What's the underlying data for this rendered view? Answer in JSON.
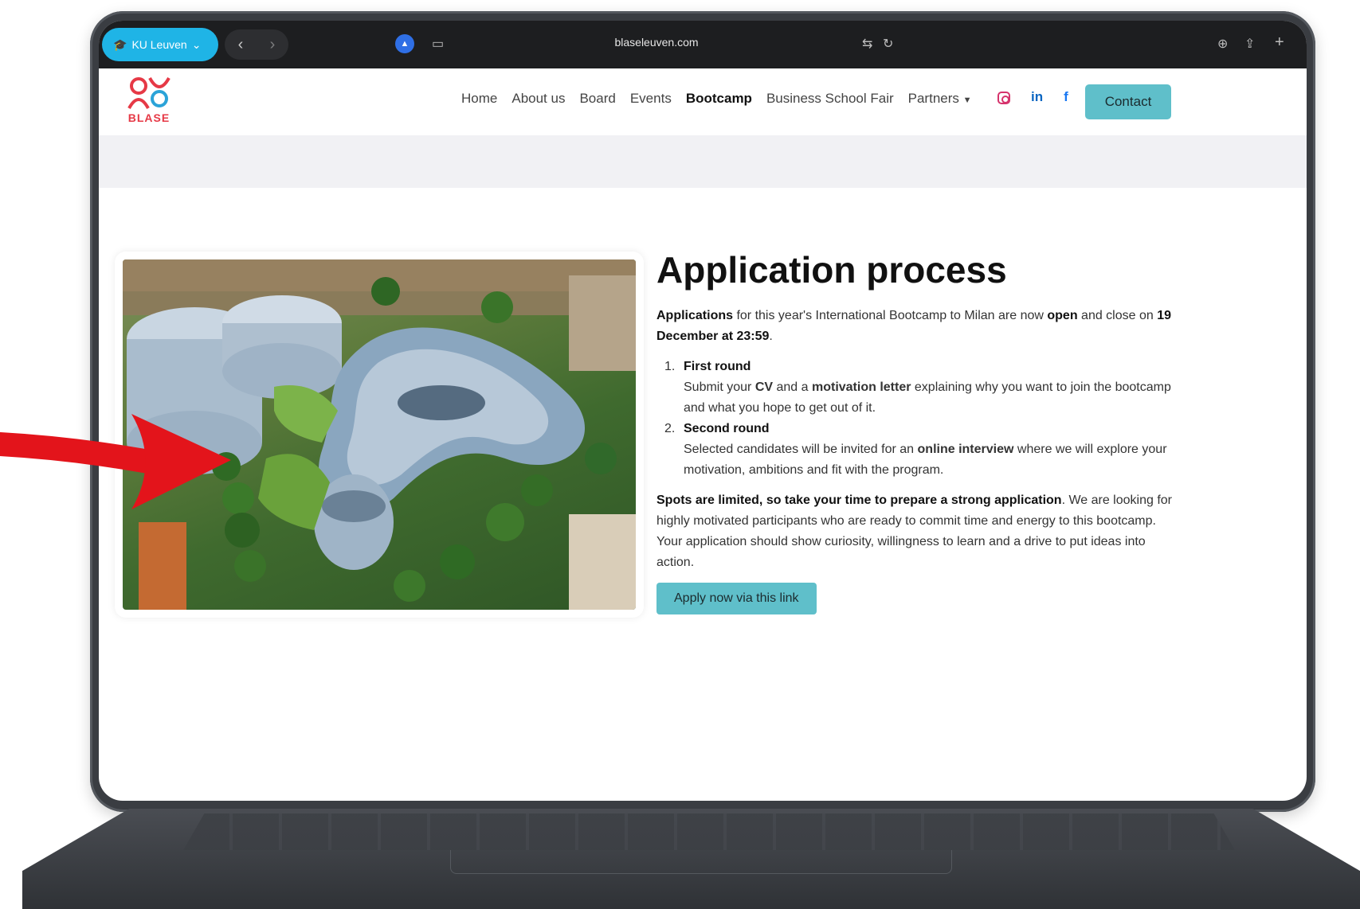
{
  "browser": {
    "profile": "KU Leuven",
    "url": "blaseleuven.com"
  },
  "site": {
    "logo_text": "BLASE",
    "nav": [
      "Home",
      "About us",
      "Board",
      "Events",
      "Bootcamp",
      "Business School Fair",
      "Partners"
    ],
    "active_nav": "Bootcamp",
    "contact_label": "Contact"
  },
  "content": {
    "title": "Application process",
    "intro_bold1": "Applications",
    "intro_text1": " for this year's International Bootcamp to Milan are now ",
    "intro_bold2": "open",
    "intro_text2": " and close on ",
    "intro_bold3": "19 December at 23:59",
    "intro_text3": ".",
    "steps": [
      {
        "number": "1.",
        "title": "First round",
        "pre": "Submit your ",
        "b1": "CV",
        "mid": " and a ",
        "b2": "motivation letter",
        "post": " explaining why you want to join the bootcamp and what you hope to get out of it."
      },
      {
        "number": "2.",
        "title": "Second round",
        "pre": "Selected candidates will be invited for an ",
        "b1": "online interview",
        "post": " where we will explore your motivation, ambitions and fit with the program."
      }
    ],
    "outro_bold": "Spots are limited, so take your time to prepare a strong application",
    "outro_text": ". We are looking for highly motivated participants who are ready to commit time and energy to this bootcamp. Your application should show curiosity, willingness to learn and a drive to put ideas into action.",
    "apply_label": "Apply now via this link"
  },
  "colors": {
    "accent": "#5fbfca",
    "logo_red": "#e63946",
    "logo_blue": "#2ba3d8",
    "profile_blue": "#1fb4e6",
    "arrow_red": "#e3141b"
  }
}
